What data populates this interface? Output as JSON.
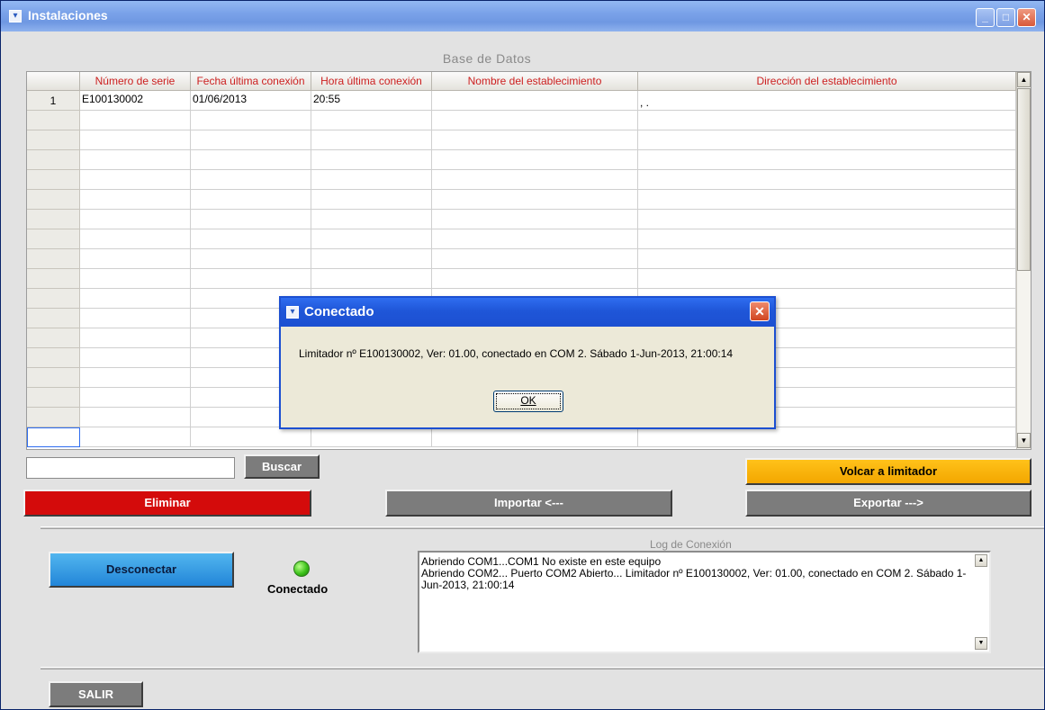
{
  "window": {
    "title": "Instalaciones"
  },
  "db": {
    "title": "Base de Datos",
    "columns": [
      "Número de serie",
      "Fecha última conexión",
      "Hora última conexión",
      "Nombre del establecimiento",
      "Dirección del establecimiento"
    ],
    "rows": [
      {
        "index": "1",
        "serial": "E100130002",
        "date": "01/06/2013",
        "time": "20:55",
        "name": "",
        "address": ", ."
      }
    ]
  },
  "search": {
    "value": "",
    "button_label": "Buscar"
  },
  "actions": {
    "volcar_label": "Volcar a limitador",
    "eliminar_label": "Eliminar",
    "importar_label": "Importar <---",
    "exportar_label": "Exportar --->"
  },
  "connection": {
    "button_label": "Desconectar",
    "status_label": "Conectado",
    "status_color": "#3cc21a"
  },
  "log": {
    "title": "Log de Conexión",
    "lines": [
      "Abriendo COM1...COM1 No existe en este equipo",
      "Abriendo COM2... Puerto COM2 Abierto... Limitador nº E100130002, Ver: 01.00, conectado en COM 2. Sábado 1-Jun-2013, 21:00:14"
    ]
  },
  "footer": {
    "exit_label": "SALIR"
  },
  "dialog": {
    "title": "Conectado",
    "message": "Limitador nº E100130002, Ver: 01.00, conectado en COM 2. Sábado 1-Jun-2013, 21:00:14",
    "ok_label": "OK"
  },
  "colors": {
    "danger": "#d40b0b",
    "warning": "#ffc21a",
    "primary": "#2285d8",
    "neutral": "#7c7c7c",
    "header_text": "#cc1f1f"
  }
}
